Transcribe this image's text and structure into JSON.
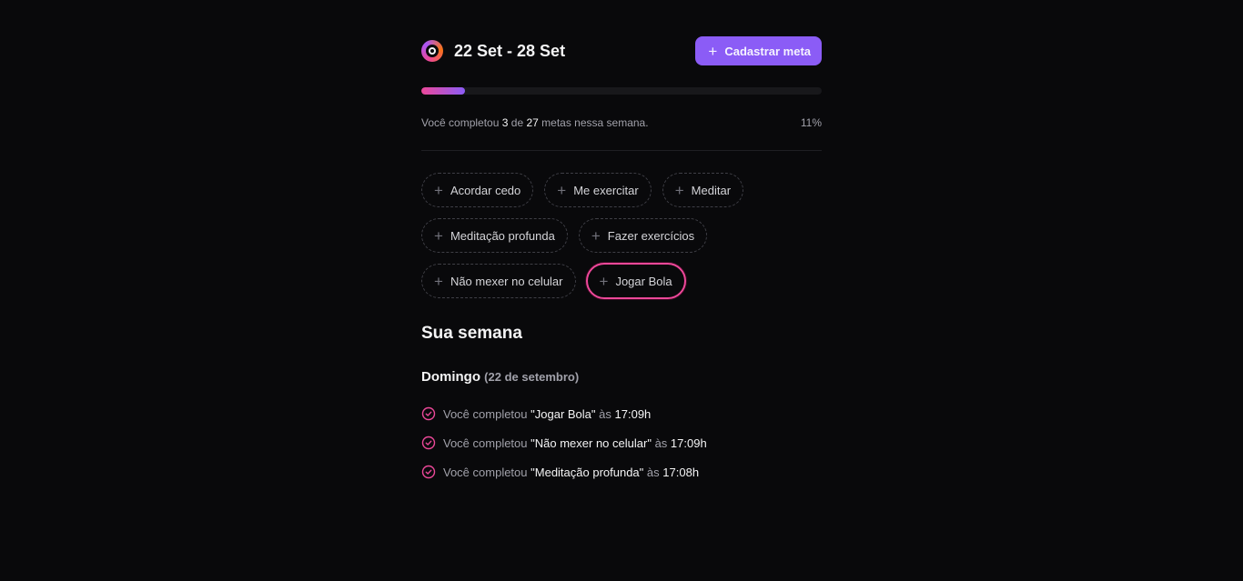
{
  "header": {
    "week_range": "22 Set - 28 Set",
    "create_button_label": "Cadastrar meta",
    "logo_icon": "in-orbit-logo-icon",
    "plus_icon": "plus-icon"
  },
  "summary": {
    "completed": "3",
    "total": "27",
    "progress_percent_label": "11%",
    "progress_fraction": 0.11,
    "prefix": "Você completou",
    "middle": "de",
    "suffix": "metas nessa semana."
  },
  "pending_goals": [
    {
      "label": "Acordar cedo"
    },
    {
      "label": "Me exercitar"
    },
    {
      "label": "Meditar"
    },
    {
      "label": "Meditação profunda"
    },
    {
      "label": "Fazer exercícios"
    },
    {
      "label": "Não mexer no celular"
    },
    {
      "label": "Jogar Bola"
    }
  ],
  "week_section": {
    "title": "Sua semana",
    "days": [
      {
        "weekday": "Domingo",
        "date": "(22 de setembro)",
        "completions": [
          {
            "prefix": "Você completou",
            "goal": "\"Jogar Bola\"",
            "at": "às",
            "time": "17:09h"
          },
          {
            "prefix": "Você completou",
            "goal": "\"Não mexer no celular\"",
            "at": "às",
            "time": "17:09h"
          },
          {
            "prefix": "Você completou",
            "goal": "\"Meditação profunda\"",
            "at": "às",
            "time": "17:08h"
          }
        ]
      }
    ]
  },
  "colors": {
    "background": "#09090b",
    "accent": "#8b5cf6",
    "pink": "#ec4899"
  }
}
